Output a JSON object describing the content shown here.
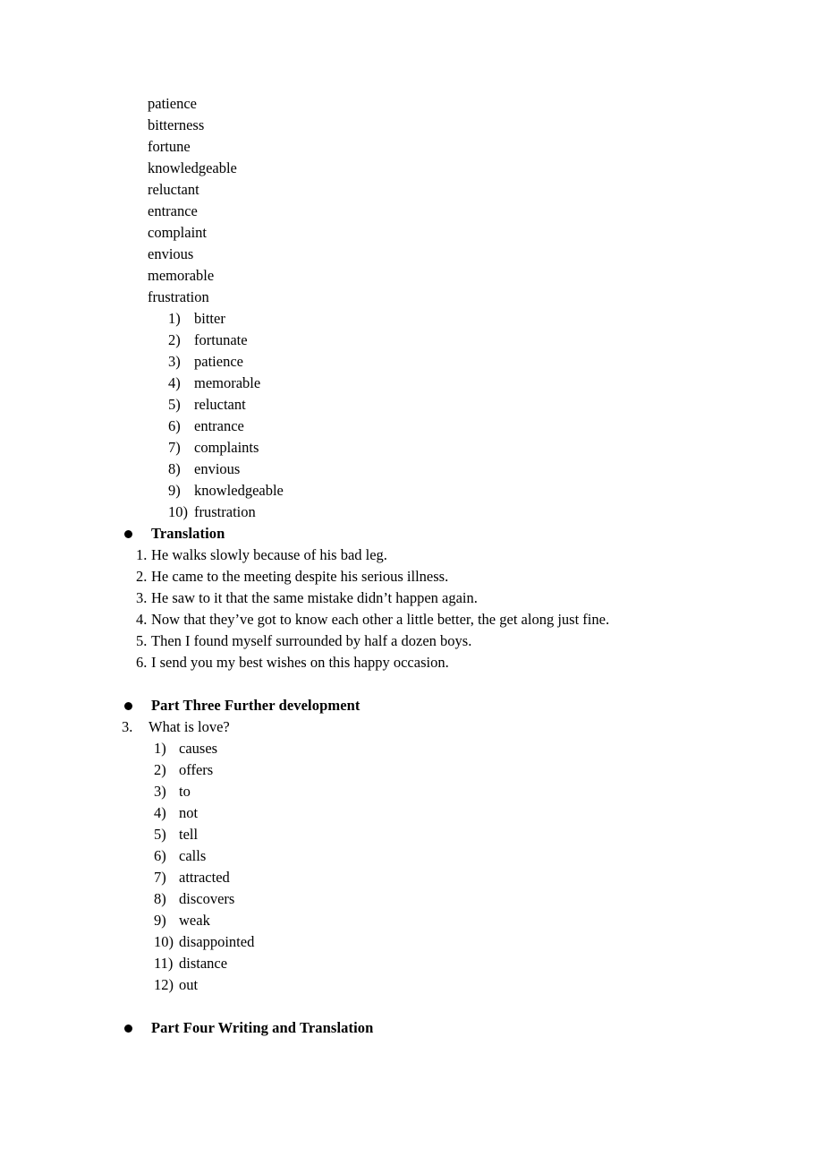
{
  "document": {
    "word_list": [
      "patience",
      "bitterness",
      "fortune",
      "knowledgeable",
      "reluctant",
      "entrance",
      "complaint",
      "envious",
      "memorable",
      "frustration"
    ],
    "answers_list": [
      {
        "marker": "1)",
        "text": "bitter"
      },
      {
        "marker": "2)",
        "text": "fortunate"
      },
      {
        "marker": "3)",
        "text": "patience"
      },
      {
        "marker": "4)",
        "text": "memorable"
      },
      {
        "marker": "5)",
        "text": "reluctant"
      },
      {
        "marker": "6)",
        "text": "entrance"
      },
      {
        "marker": "7)",
        "text": "complaints"
      },
      {
        "marker": "8)",
        "text": "envious"
      },
      {
        "marker": "9)",
        "text": "knowledgeable"
      },
      {
        "marker": "10)",
        "text": "frustration"
      }
    ],
    "translation_heading": "Translation",
    "translation_sentences": [
      {
        "marker": "1.",
        "text": "He walks slowly because of his bad leg."
      },
      {
        "marker": "2.",
        "text": "He came to the meeting despite his serious illness."
      },
      {
        "marker": "3.",
        "text": "He saw to it that the same mistake didn’t happen again."
      },
      {
        "marker": "4.",
        "text": "Now that they’ve got to know each other a little better, the get along just fine."
      },
      {
        "marker": "5.",
        "text": "Then I found myself surrounded by half a dozen boys."
      },
      {
        "marker": "6.",
        "text": "I send you my best wishes on this happy occasion."
      }
    ],
    "part_three_heading": "Part Three Further development",
    "question_three": {
      "marker": "3.",
      "text": "What is love?"
    },
    "question_three_answers": [
      {
        "marker": "1)",
        "text": "causes"
      },
      {
        "marker": "2)",
        "text": "offers"
      },
      {
        "marker": "3)",
        "text": "to"
      },
      {
        "marker": "4)",
        "text": "not"
      },
      {
        "marker": "5)",
        "text": "tell"
      },
      {
        "marker": "6)",
        "text": "calls"
      },
      {
        "marker": "7)",
        "text": "attracted"
      },
      {
        "marker": "8)",
        "text": "discovers"
      },
      {
        "marker": "9)",
        "text": "weak"
      },
      {
        "marker": "10)",
        "text": "disappointed"
      },
      {
        "marker": "11)",
        "text": "distance"
      },
      {
        "marker": "12)",
        "text": "out"
      }
    ],
    "part_four_heading": "Part Four Writing and Translation"
  }
}
